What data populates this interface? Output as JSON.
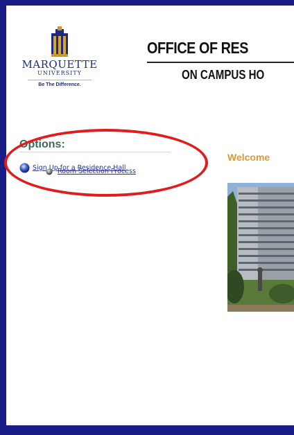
{
  "logo": {
    "name": "MARQUETTE",
    "univ": "UNIVERSITY",
    "tagline": "Be The Difference."
  },
  "header": {
    "line1": "OFFICE OF RES",
    "line2": "ON CAMPUS HO"
  },
  "options": {
    "title": "Options:",
    "items": [
      {
        "label": "Sign Up for a Residence Hall",
        "icon": "globe-icon"
      },
      {
        "label": "Room Selection Process",
        "icon": "bullet-icon"
      }
    ]
  },
  "main": {
    "welcome": "Welcome"
  },
  "colors": {
    "frame": "#1a1c86",
    "options_title": "#3c6a54",
    "link": "#2a3592",
    "welcome": "#e09a2c",
    "annotation": "#e21b1b"
  }
}
